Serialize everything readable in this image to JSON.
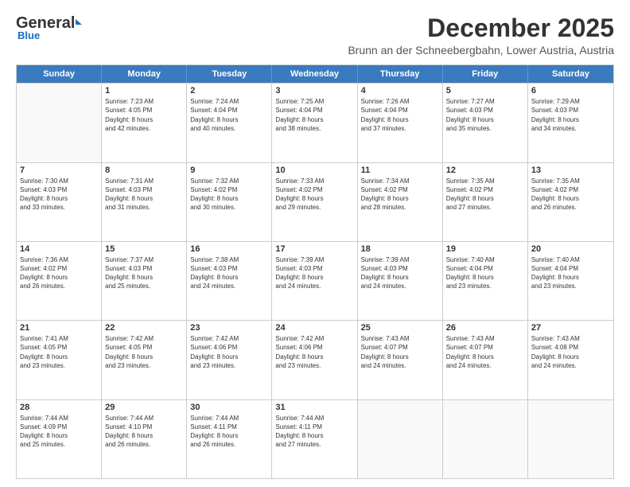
{
  "header": {
    "logo_general": "General",
    "logo_blue": "Blue",
    "month_title": "December 2025",
    "location": "Brunn an der Schneebergbahn, Lower Austria, Austria"
  },
  "weekdays": [
    "Sunday",
    "Monday",
    "Tuesday",
    "Wednesday",
    "Thursday",
    "Friday",
    "Saturday"
  ],
  "rows": [
    [
      {
        "day": "",
        "lines": [],
        "empty": true
      },
      {
        "day": "1",
        "lines": [
          "Sunrise: 7:23 AM",
          "Sunset: 4:05 PM",
          "Daylight: 8 hours",
          "and 42 minutes."
        ]
      },
      {
        "day": "2",
        "lines": [
          "Sunrise: 7:24 AM",
          "Sunset: 4:04 PM",
          "Daylight: 8 hours",
          "and 40 minutes."
        ]
      },
      {
        "day": "3",
        "lines": [
          "Sunrise: 7:25 AM",
          "Sunset: 4:04 PM",
          "Daylight: 8 hours",
          "and 38 minutes."
        ]
      },
      {
        "day": "4",
        "lines": [
          "Sunrise: 7:26 AM",
          "Sunset: 4:04 PM",
          "Daylight: 8 hours",
          "and 37 minutes."
        ]
      },
      {
        "day": "5",
        "lines": [
          "Sunrise: 7:27 AM",
          "Sunset: 4:03 PM",
          "Daylight: 8 hours",
          "and 35 minutes."
        ]
      },
      {
        "day": "6",
        "lines": [
          "Sunrise: 7:29 AM",
          "Sunset: 4:03 PM",
          "Daylight: 8 hours",
          "and 34 minutes."
        ]
      }
    ],
    [
      {
        "day": "7",
        "lines": [
          "Sunrise: 7:30 AM",
          "Sunset: 4:03 PM",
          "Daylight: 8 hours",
          "and 33 minutes."
        ]
      },
      {
        "day": "8",
        "lines": [
          "Sunrise: 7:31 AM",
          "Sunset: 4:03 PM",
          "Daylight: 8 hours",
          "and 31 minutes."
        ]
      },
      {
        "day": "9",
        "lines": [
          "Sunrise: 7:32 AM",
          "Sunset: 4:02 PM",
          "Daylight: 8 hours",
          "and 30 minutes."
        ]
      },
      {
        "day": "10",
        "lines": [
          "Sunrise: 7:33 AM",
          "Sunset: 4:02 PM",
          "Daylight: 8 hours",
          "and 29 minutes."
        ]
      },
      {
        "day": "11",
        "lines": [
          "Sunrise: 7:34 AM",
          "Sunset: 4:02 PM",
          "Daylight: 8 hours",
          "and 28 minutes."
        ]
      },
      {
        "day": "12",
        "lines": [
          "Sunrise: 7:35 AM",
          "Sunset: 4:02 PM",
          "Daylight: 8 hours",
          "and 27 minutes."
        ]
      },
      {
        "day": "13",
        "lines": [
          "Sunrise: 7:35 AM",
          "Sunset: 4:02 PM",
          "Daylight: 8 hours",
          "and 26 minutes."
        ]
      }
    ],
    [
      {
        "day": "14",
        "lines": [
          "Sunrise: 7:36 AM",
          "Sunset: 4:02 PM",
          "Daylight: 8 hours",
          "and 26 minutes."
        ]
      },
      {
        "day": "15",
        "lines": [
          "Sunrise: 7:37 AM",
          "Sunset: 4:03 PM",
          "Daylight: 8 hours",
          "and 25 minutes."
        ]
      },
      {
        "day": "16",
        "lines": [
          "Sunrise: 7:38 AM",
          "Sunset: 4:03 PM",
          "Daylight: 8 hours",
          "and 24 minutes."
        ]
      },
      {
        "day": "17",
        "lines": [
          "Sunrise: 7:39 AM",
          "Sunset: 4:03 PM",
          "Daylight: 8 hours",
          "and 24 minutes."
        ]
      },
      {
        "day": "18",
        "lines": [
          "Sunrise: 7:39 AM",
          "Sunset: 4:03 PM",
          "Daylight: 8 hours",
          "and 24 minutes."
        ]
      },
      {
        "day": "19",
        "lines": [
          "Sunrise: 7:40 AM",
          "Sunset: 4:04 PM",
          "Daylight: 8 hours",
          "and 23 minutes."
        ]
      },
      {
        "day": "20",
        "lines": [
          "Sunrise: 7:40 AM",
          "Sunset: 4:04 PM",
          "Daylight: 8 hours",
          "and 23 minutes."
        ]
      }
    ],
    [
      {
        "day": "21",
        "lines": [
          "Sunrise: 7:41 AM",
          "Sunset: 4:05 PM",
          "Daylight: 8 hours",
          "and 23 minutes."
        ]
      },
      {
        "day": "22",
        "lines": [
          "Sunrise: 7:42 AM",
          "Sunset: 4:05 PM",
          "Daylight: 8 hours",
          "and 23 minutes."
        ]
      },
      {
        "day": "23",
        "lines": [
          "Sunrise: 7:42 AM",
          "Sunset: 4:06 PM",
          "Daylight: 8 hours",
          "and 23 minutes."
        ]
      },
      {
        "day": "24",
        "lines": [
          "Sunrise: 7:42 AM",
          "Sunset: 4:06 PM",
          "Daylight: 8 hours",
          "and 23 minutes."
        ]
      },
      {
        "day": "25",
        "lines": [
          "Sunrise: 7:43 AM",
          "Sunset: 4:07 PM",
          "Daylight: 8 hours",
          "and 24 minutes."
        ]
      },
      {
        "day": "26",
        "lines": [
          "Sunrise: 7:43 AM",
          "Sunset: 4:07 PM",
          "Daylight: 8 hours",
          "and 24 minutes."
        ]
      },
      {
        "day": "27",
        "lines": [
          "Sunrise: 7:43 AM",
          "Sunset: 4:08 PM",
          "Daylight: 8 hours",
          "and 24 minutes."
        ]
      }
    ],
    [
      {
        "day": "28",
        "lines": [
          "Sunrise: 7:44 AM",
          "Sunset: 4:09 PM",
          "Daylight: 8 hours",
          "and 25 minutes."
        ]
      },
      {
        "day": "29",
        "lines": [
          "Sunrise: 7:44 AM",
          "Sunset: 4:10 PM",
          "Daylight: 8 hours",
          "and 26 minutes."
        ]
      },
      {
        "day": "30",
        "lines": [
          "Sunrise: 7:44 AM",
          "Sunset: 4:11 PM",
          "Daylight: 8 hours",
          "and 26 minutes."
        ]
      },
      {
        "day": "31",
        "lines": [
          "Sunrise: 7:44 AM",
          "Sunset: 4:11 PM",
          "Daylight: 8 hours",
          "and 27 minutes."
        ]
      },
      {
        "day": "",
        "lines": [],
        "empty": true
      },
      {
        "day": "",
        "lines": [],
        "empty": true
      },
      {
        "day": "",
        "lines": [],
        "empty": true
      }
    ]
  ]
}
